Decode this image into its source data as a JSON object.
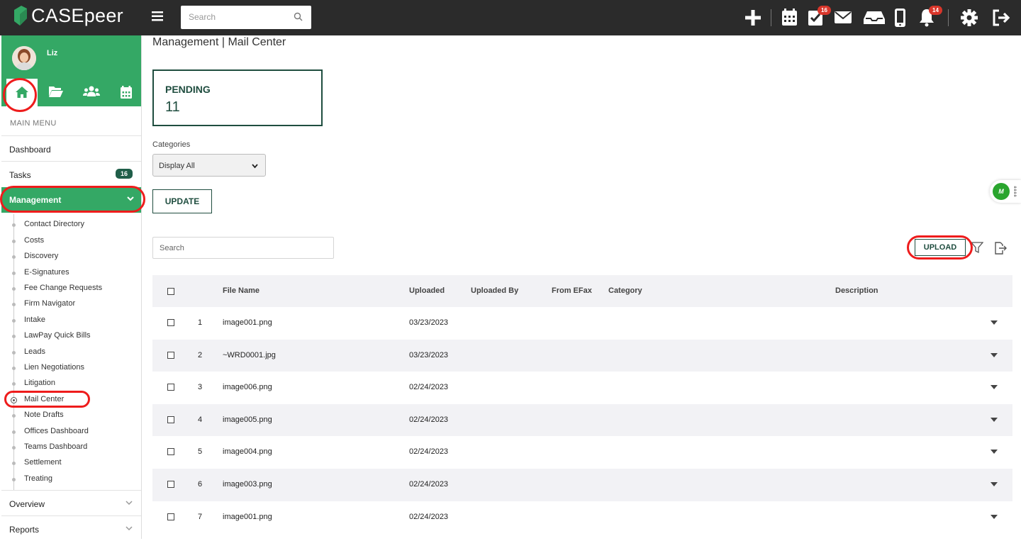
{
  "app": {
    "logo": "CASEpeer"
  },
  "topbar": {
    "search_placeholder": "Search",
    "tasks_badge": "16",
    "notifications_badge": "14"
  },
  "user": {
    "name": "Liz"
  },
  "sidebar": {
    "main_menu": "MAIN MENU",
    "dashboard": "Dashboard",
    "tasks": "Tasks",
    "tasks_count": "16",
    "management": "Management",
    "submenu": [
      "Contact Directory",
      "Costs",
      "Discovery",
      "E-Signatures",
      "Fee Change Requests",
      "Firm Navigator",
      "Intake",
      "LawPay Quick Bills",
      "Leads",
      "Lien Negotiations",
      "Litigation",
      "Mail Center",
      "Note Drafts",
      "Offices Dashboard",
      "Teams Dashboard",
      "Settlement",
      "Treating"
    ],
    "active_submenu": "Mail Center",
    "overview": "Overview",
    "reports": "Reports"
  },
  "main": {
    "title": "Management | Mail Center",
    "pending_label": "PENDING",
    "pending_count": "11",
    "categories_label": "Categories",
    "categories_selected": "Display All",
    "update_label": "UPDATE",
    "search_placeholder": "Search",
    "upload_label": "UPLOAD",
    "mm_widget": "M"
  },
  "table": {
    "columns": [
      "File Name",
      "Uploaded",
      "Uploaded By",
      "From EFax",
      "Category",
      "Description"
    ],
    "rows": [
      {
        "num": "1",
        "file": "image001.png",
        "uploaded": "03/23/2023"
      },
      {
        "num": "2",
        "file": "~WRD0001.jpg",
        "uploaded": "03/23/2023"
      },
      {
        "num": "3",
        "file": "image006.png",
        "uploaded": "02/24/2023"
      },
      {
        "num": "4",
        "file": "image005.png",
        "uploaded": "02/24/2023"
      },
      {
        "num": "5",
        "file": "image004.png",
        "uploaded": "02/24/2023"
      },
      {
        "num": "6",
        "file": "image003.png",
        "uploaded": "02/24/2023"
      },
      {
        "num": "7",
        "file": "image001.png",
        "uploaded": "02/24/2023"
      }
    ]
  },
  "colors": {
    "brand_green": "#34a865",
    "dark_green": "#1f4d3f",
    "highlight": "#ee1c1c",
    "topbar": "#2b2b2b"
  }
}
